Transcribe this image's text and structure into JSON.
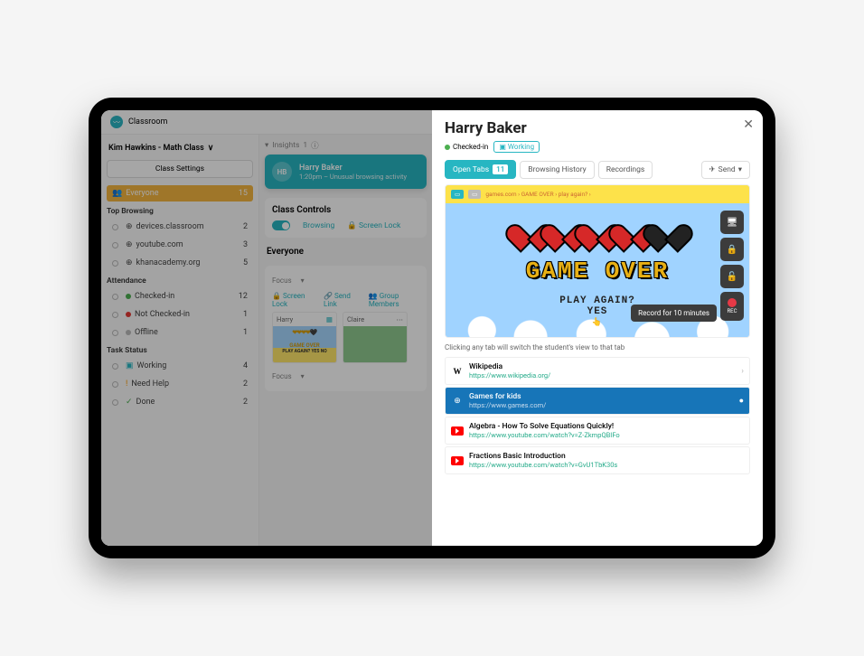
{
  "app": {
    "name": "Classroom"
  },
  "sidebar": {
    "class_name": "Kim Hawkins - Math Class",
    "settings_btn": "Class Settings",
    "everyone": {
      "label": "Everyone",
      "count": "15"
    },
    "top_browsing_header": "Top Browsing",
    "top_browsing": [
      {
        "label": "devices.classroom",
        "count": "2"
      },
      {
        "label": "youtube.com",
        "count": "3"
      },
      {
        "label": "khanacademy.org",
        "count": "5"
      }
    ],
    "attendance_header": "Attendance",
    "attendance": [
      {
        "label": "Checked-in",
        "count": "12",
        "color": "green"
      },
      {
        "label": "Not Checked-in",
        "count": "1",
        "color": "red"
      },
      {
        "label": "Offline",
        "count": "1",
        "color": "grey"
      }
    ],
    "task_header": "Task Status",
    "tasks": [
      {
        "label": "Working",
        "count": "4",
        "color": "cyan"
      },
      {
        "label": "Need Help",
        "count": "2",
        "color": "orange"
      },
      {
        "label": "Done",
        "count": "2",
        "color": "green"
      }
    ]
  },
  "main": {
    "insights_label": "Insights",
    "insights_count": "1",
    "insight": {
      "initials": "HB",
      "name": "Harry Baker",
      "subtitle": "1:20pm – Unusual browsing activity"
    },
    "controls": {
      "title": "Class Controls",
      "browsing": "Browsing",
      "screen_lock": "Screen Lock"
    },
    "everyone_title": "Everyone",
    "focus": "Focus",
    "action_screenlock": "Screen Lock",
    "action_sendlink": "Send Link",
    "action_groupmembers": "Group Members",
    "students": [
      {
        "name": "Harry",
        "thumb_text": "GAME OVER",
        "sub": "PLAY AGAIN? YES NO"
      },
      {
        "name": "Claire",
        "thumb_text": "",
        "sub": ""
      }
    ]
  },
  "panel": {
    "student_name": "Harry Baker",
    "checked_in": "Checked-in",
    "working": "Working",
    "tabs": {
      "open_tabs": "Open Tabs",
      "open_tabs_count": "11",
      "history": "Browsing History",
      "recordings": "Recordings",
      "send": "Send"
    },
    "game_over": "GAME OVER",
    "play_again": "PLAY AGAIN?",
    "yes": "YES",
    "record_tooltip": "Record for 10 minutes",
    "rec_label": "REC",
    "hint": "Clicking any tab will switch the student's view to that tab",
    "tab_list": [
      {
        "icon": "W",
        "title": "Wikipedia",
        "url": "https://www.wikipedia.org/",
        "selected": false,
        "favicon": "wiki"
      },
      {
        "icon": "🎯",
        "title": "Games for kids",
        "url": "https://www.games.com/",
        "selected": true,
        "favicon": "target"
      },
      {
        "icon": "yt",
        "title": "Algebra - How To Solve Equations Quickly!",
        "url": "https://www.youtube.com/watch?v=Z-ZkmpQBIFo",
        "selected": false,
        "favicon": "youtube"
      },
      {
        "icon": "yt",
        "title": "Fractions Basic Introduction",
        "url": "https://www.youtube.com/watch?v=GvU1TbK30s",
        "selected": false,
        "favicon": "youtube"
      }
    ]
  }
}
